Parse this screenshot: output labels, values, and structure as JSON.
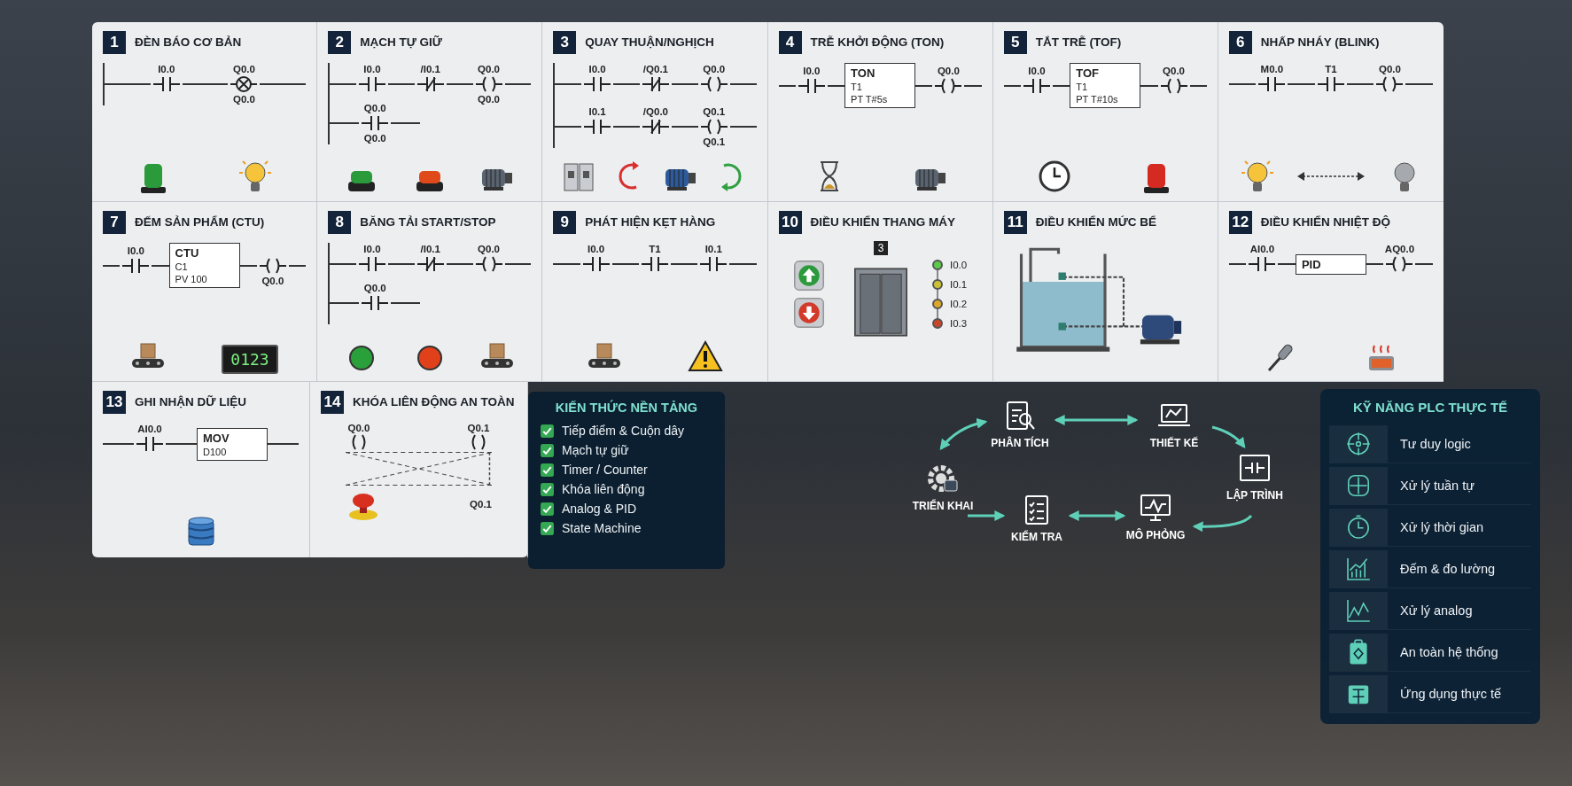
{
  "cards": [
    {
      "number": "1",
      "title": "ĐÈN BÁO CƠ BẢN",
      "kind": "ladder",
      "rail": true,
      "rungs": [
        {
          "kind": "main",
          "elements": [
            {
              "kind": "no",
              "label": "I0.0"
            },
            {
              "kind": "lamp",
              "label": "Q0.0",
              "sub": "Q0.0"
            }
          ]
        }
      ]
    },
    {
      "number": "2",
      "title": "MẠCH TỰ GIỮ",
      "kind": "ladder",
      "rail": true,
      "rungs": [
        {
          "kind": "main",
          "elements": [
            {
              "kind": "no",
              "label": "I0.0"
            },
            {
              "kind": "nc",
              "label": "/I0.1"
            },
            {
              "kind": "coil",
              "label": "Q0.0",
              "sub": "Q0.0"
            }
          ]
        },
        {
          "kind": "branch",
          "elements": [
            {
              "kind": "no",
              "label": "Q0.0",
              "sub": "Q0.0"
            }
          ]
        }
      ]
    },
    {
      "number": "3",
      "title": "QUAY THUẬN/NGHỊCH",
      "kind": "ladder",
      "rail": true,
      "rungs": [
        {
          "kind": "main",
          "elements": [
            {
              "kind": "no",
              "label": "I0.0"
            },
            {
              "kind": "nc",
              "label": "/Q0.1"
            },
            {
              "kind": "coil",
              "label": "Q0.0"
            }
          ]
        },
        {
          "kind": "main",
          "elements": [
            {
              "kind": "no",
              "label": "I0.1"
            },
            {
              "kind": "nc",
              "label": "/Q0.0"
            },
            {
              "kind": "coil",
              "label": "Q0.1",
              "sub": "Q0.1"
            }
          ]
        }
      ]
    },
    {
      "number": "4",
      "title": "TRỄ KHỞI ĐỘNG (TON)",
      "kind": "ladder",
      "rail": false,
      "rungs": [
        {
          "kind": "main",
          "elements": [
            {
              "kind": "no",
              "label": "I0.0"
            },
            {
              "kind": "box",
              "lines": [
                "TON",
                "T1",
                "PT  T#5s"
              ]
            },
            {
              "kind": "coil",
              "label": "Q0.0"
            }
          ]
        }
      ]
    },
    {
      "number": "5",
      "title": "TẮT TRỄ (TOF)",
      "kind": "ladder",
      "rail": false,
      "rungs": [
        {
          "kind": "main",
          "elements": [
            {
              "kind": "no",
              "label": "I0.0"
            },
            {
              "kind": "box",
              "lines": [
                "TOF",
                "T1",
                "PT  T#10s"
              ]
            },
            {
              "kind": "coil",
              "label": "Q0.0"
            }
          ]
        }
      ]
    },
    {
      "number": "6",
      "title": "NHẤP NHÁY (BLINK)",
      "kind": "ladder",
      "rail": false,
      "rungs": [
        {
          "kind": "main",
          "elements": [
            {
              "kind": "no",
              "label": "M0.0"
            },
            {
              "kind": "no",
              "label": "T1"
            },
            {
              "kind": "coil",
              "label": "Q0.0"
            }
          ]
        }
      ]
    },
    {
      "number": "7",
      "title": "ĐẾM SẢN PHẨM (CTU)",
      "kind": "ladder",
      "rail": false,
      "display": "0123",
      "rungs": [
        {
          "kind": "main",
          "elements": [
            {
              "kind": "no",
              "label": "I0.0"
            },
            {
              "kind": "box",
              "lines": [
                "CTU",
                "C1",
                "PV  100"
              ]
            },
            {
              "kind": "coil",
              "sub": "Q0.0"
            }
          ]
        }
      ]
    },
    {
      "number": "8",
      "title": "BĂNG TẢI START/STOP",
      "kind": "ladder",
      "rail": true,
      "rungs": [
        {
          "kind": "main",
          "elements": [
            {
              "kind": "no",
              "label": "I0.0"
            },
            {
              "kind": "nc",
              "label": "/I0.1"
            },
            {
              "kind": "coil",
              "label": "Q0.0"
            }
          ]
        },
        {
          "kind": "branch",
          "elements": [
            {
              "kind": "no",
              "label": "Q0.0"
            }
          ]
        }
      ]
    },
    {
      "number": "9",
      "title": "PHÁT HIỆN KẸT HÀNG",
      "kind": "ladder",
      "rail": false,
      "rungs": [
        {
          "kind": "main",
          "elements": [
            {
              "kind": "no",
              "label": "I0.0"
            },
            {
              "kind": "no",
              "label": "T1"
            },
            {
              "kind": "no",
              "label": "I0.1"
            }
          ]
        }
      ]
    },
    {
      "number": "10",
      "title": "ĐIỀU KHIỂN THANG MÁY",
      "kind": "elevator",
      "floor": "3",
      "sensors": [
        {
          "label": "I0.0",
          "color": "#5cc94a"
        },
        {
          "label": "I0.1",
          "color": "#c9c236"
        },
        {
          "label": "I0.2",
          "color": "#d9a72a"
        },
        {
          "label": "I0.3",
          "color": "#c9452a"
        }
      ]
    },
    {
      "number": "11",
      "title": "ĐIỀU KHIỂN MỨC BỂ",
      "kind": "tank"
    },
    {
      "number": "12",
      "title": "ĐIỀU KHIỂN NHIỆT ĐỘ",
      "kind": "ladder",
      "rail": false,
      "rungs": [
        {
          "kind": "main",
          "elements": [
            {
              "kind": "no",
              "label": "AI0.0"
            },
            {
              "kind": "box",
              "lines": [
                "PID"
              ]
            },
            {
              "kind": "coil",
              "label": "AQ0.0"
            }
          ]
        }
      ]
    },
    {
      "number": "13",
      "title": "GHI NHẬN DỮ LIỆU",
      "kind": "ladder",
      "rail": false,
      "rungs": [
        {
          "kind": "main",
          "elements": [
            {
              "kind": "no",
              "label": "AI0.0"
            },
            {
              "kind": "box",
              "lines": [
                "MOV",
                "D100"
              ]
            }
          ]
        }
      ]
    },
    {
      "number": "14",
      "title": "KHÓA LIÊN ĐỘNG AN TOÀN",
      "kind": "interlock",
      "coils": [
        "Q0.0",
        "Q0.1",
        "Q0.1"
      ]
    }
  ],
  "knowledge": {
    "title": "KIẾN THỨC NỀN TẢNG",
    "items": [
      {
        "label": "Tiếp điểm & Cuộn dây",
        "checked": true
      },
      {
        "label": "Mạch tự giữ",
        "checked": true
      },
      {
        "label": "Timer / Counter",
        "checked": true
      },
      {
        "label": "Khóa liên động",
        "checked": true
      },
      {
        "label": "Analog & PID",
        "checked": true
      },
      {
        "label": "State Machine",
        "checked": true
      }
    ]
  },
  "workflow": {
    "steps": [
      {
        "kind": "analyze",
        "label": "PHÂN TÍCH"
      },
      {
        "kind": "design",
        "label": "THIẾT KẾ"
      },
      {
        "kind": "program",
        "label": "LẬP TRÌNH"
      },
      {
        "kind": "simulate",
        "label": "MÔ PHỎNG"
      },
      {
        "kind": "test",
        "label": "KIỂM TRA"
      },
      {
        "kind": "deploy",
        "label": "TRIỂN KHAI"
      }
    ]
  },
  "skills": {
    "title": "KỸ NĂNG PLC THỰC TẾ",
    "items": [
      {
        "kind": "logic",
        "label": "Tư duy logic"
      },
      {
        "kind": "sequence",
        "label": "Xử lý tuần tự"
      },
      {
        "kind": "time",
        "label": "Xử lý thời gian"
      },
      {
        "kind": "count",
        "label": "Đếm & đo lường"
      },
      {
        "kind": "analog",
        "label": "Xử lý analog"
      },
      {
        "kind": "safety",
        "label": "An toàn hệ thống"
      },
      {
        "kind": "apply",
        "label": "Ứng dụng thực tế"
      }
    ]
  }
}
